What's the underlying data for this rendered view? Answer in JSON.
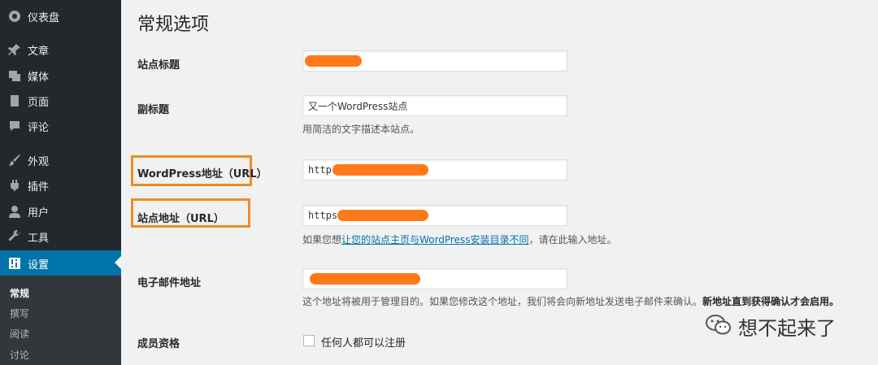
{
  "sidebar": {
    "items": [
      {
        "label": "仪表盘",
        "icon": "dashboard-icon"
      },
      {
        "label": "文章",
        "icon": "pushpin-icon"
      },
      {
        "label": "媒体",
        "icon": "media-icon"
      },
      {
        "label": "页面",
        "icon": "page-icon"
      },
      {
        "label": "评论",
        "icon": "comment-icon"
      },
      {
        "label": "外观",
        "icon": "brush-icon"
      },
      {
        "label": "插件",
        "icon": "plugin-icon"
      },
      {
        "label": "用户",
        "icon": "user-icon"
      },
      {
        "label": "工具",
        "icon": "wrench-icon"
      },
      {
        "label": "设置",
        "icon": "settings-icon"
      }
    ],
    "submenu": [
      "常规",
      "撰写",
      "阅读",
      "讨论"
    ]
  },
  "page": {
    "title": "常规选项"
  },
  "form": {
    "site_title": {
      "label": "站点标题",
      "value": ""
    },
    "tagline": {
      "label": "副标题",
      "value": "又一个WordPress站点",
      "desc": "用简洁的文字描述本站点。"
    },
    "wp_url": {
      "label": "WordPress地址（URL）",
      "value": "http"
    },
    "site_url": {
      "label": "站点地址（URL）",
      "value": "https",
      "desc_prefix": "如果您想",
      "desc_link": "让您的站点主页与WordPress安装目录不同",
      "desc_suffix": "，请在此输入地址。"
    },
    "admin_email": {
      "label": "电子邮件地址",
      "value": "",
      "desc_main": "这个地址将被用于管理目的。如果您修改这个地址，我们将会向新地址发送电子邮件来确认。",
      "desc_bold": "新地址直到获得确认才会启用。"
    },
    "membership": {
      "label": "成员资格",
      "checkbox_label": "任何人都可以注册",
      "checked": false
    }
  },
  "colors": {
    "sidebar_bg": "#23282d",
    "active_bg": "#0073aa",
    "highlight_border": "#f08a24",
    "redaction": "#ff6a00"
  },
  "watermark": {
    "text": "想不起来了",
    "icon": "wechat-icon"
  }
}
